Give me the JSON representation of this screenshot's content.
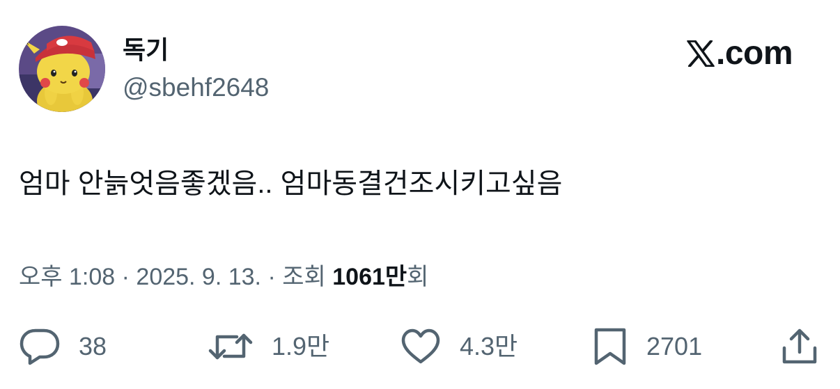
{
  "author": {
    "display_name": "독기",
    "handle": "@sbehf2648",
    "avatar": "pikachu-with-red-cap-avatar"
  },
  "brand": {
    "name": "X.com",
    "suffix": ".com",
    "icon": "x-logo-icon"
  },
  "tweet": {
    "text": "엄마 안늙엇음좋겠음.. 엄마동결건조시키고싶음"
  },
  "meta": {
    "time": "오후 1:08",
    "separator": " · ",
    "date": "2025. 9. 13.",
    "views_label": "조회",
    "views_count": "1061만",
    "views_suffix": "회"
  },
  "actions": {
    "reply": {
      "icon": "reply-bubble-icon",
      "count": "38"
    },
    "repost": {
      "icon": "repost-icon",
      "count": "1.9만"
    },
    "like": {
      "icon": "heart-icon",
      "count": "4.3만"
    },
    "bookmark": {
      "icon": "bookmark-icon",
      "count": "2701"
    },
    "share": {
      "icon": "share-upload-icon"
    }
  },
  "colors": {
    "text_primary": "#0f1419",
    "text_secondary": "#536471",
    "background": "#ffffff"
  }
}
